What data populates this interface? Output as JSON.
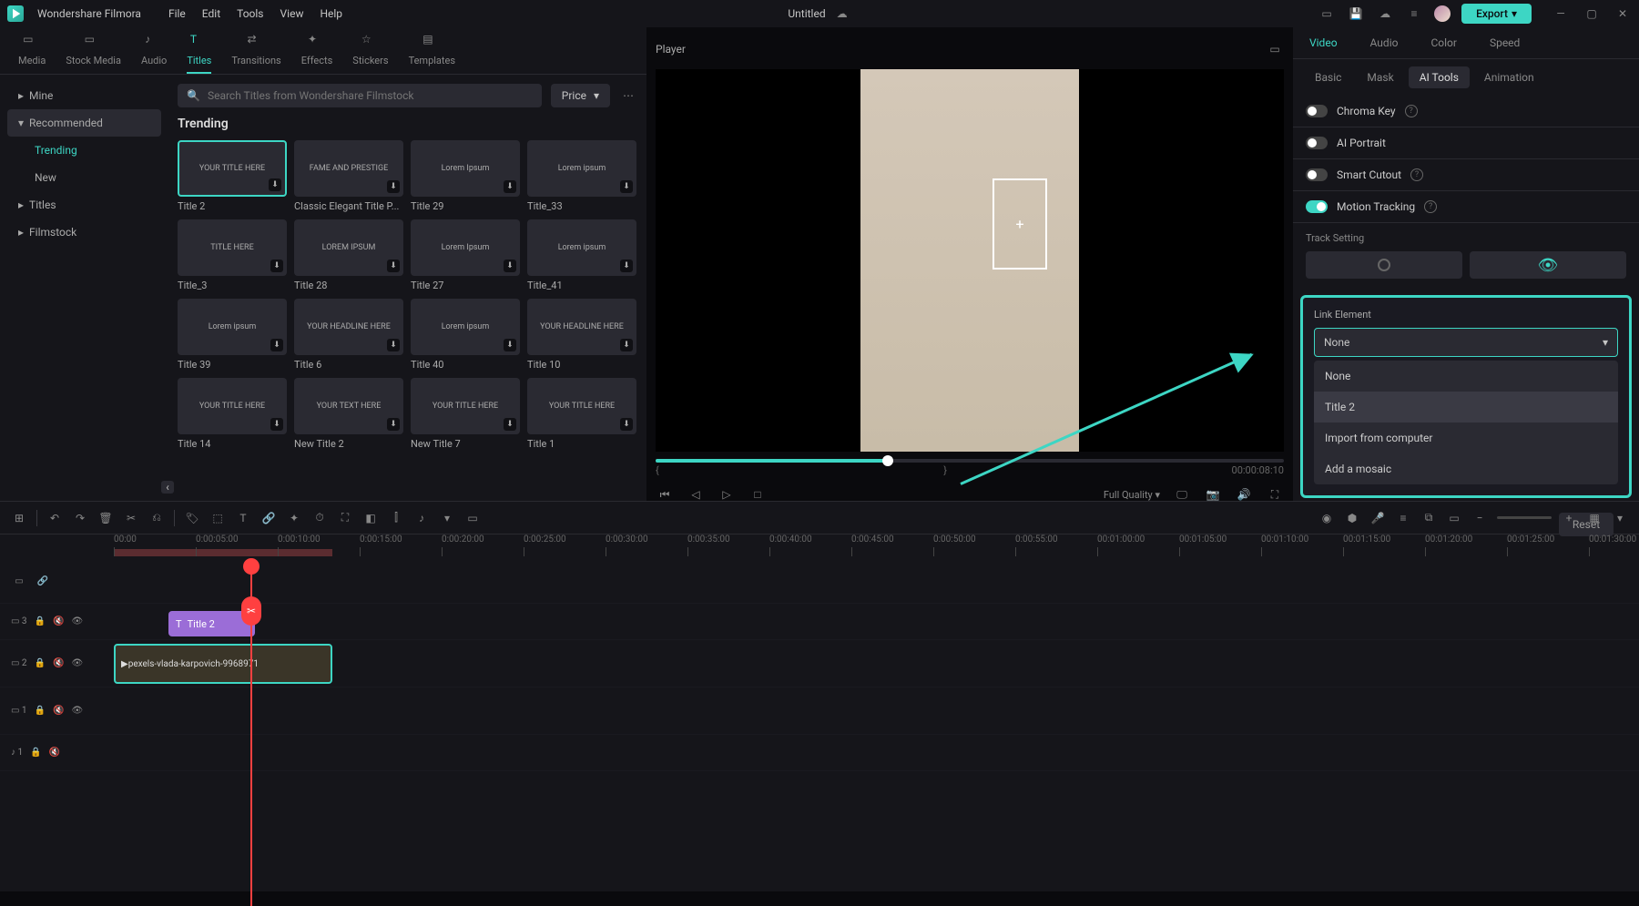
{
  "app": {
    "name": "Wondershare Filmora",
    "doc_title": "Untitled"
  },
  "menu": [
    "File",
    "Edit",
    "Tools",
    "View",
    "Help"
  ],
  "export_label": "Export",
  "media_tabs": [
    {
      "label": "Media"
    },
    {
      "label": "Stock Media"
    },
    {
      "label": "Audio"
    },
    {
      "label": "Titles",
      "active": true
    },
    {
      "label": "Transitions"
    },
    {
      "label": "Effects"
    },
    {
      "label": "Stickers"
    },
    {
      "label": "Templates"
    }
  ],
  "sidebar": {
    "mine": "Mine",
    "recommended": "Recommended",
    "trending": "Trending",
    "new": "New",
    "titles": "Titles",
    "filmstock": "Filmstock"
  },
  "search": {
    "placeholder": "Search Titles from Wondershare Filmstock"
  },
  "price_label": "Price",
  "section_title": "Trending",
  "thumbs": [
    {
      "label": "Title 2",
      "text": "YOUR TITLE HERE",
      "selected": true
    },
    {
      "label": "Classic Elegant Title P...",
      "text": "FAME AND PRESTIGE"
    },
    {
      "label": "Title 29",
      "text": "Lorem Ipsum"
    },
    {
      "label": "Title_33",
      "text": "Lorem ipsum"
    },
    {
      "label": "Title_3",
      "text": "TITLE HERE"
    },
    {
      "label": "Title 28",
      "text": "LOREM IPSUM"
    },
    {
      "label": "Title 27",
      "text": "Lorem Ipsum"
    },
    {
      "label": "Title_41",
      "text": "Lorem ipsum"
    },
    {
      "label": "Title 39",
      "text": "Lorem ipsum"
    },
    {
      "label": "Title 6",
      "text": "YOUR HEADLINE HERE"
    },
    {
      "label": "Title 40",
      "text": "Lorem ipsum"
    },
    {
      "label": "Title 10",
      "text": "YOUR HEADLINE HERE"
    },
    {
      "label": "Title 14",
      "text": "YOUR TITLE HERE"
    },
    {
      "label": "New Title 2",
      "text": "YOUR TEXT HERE"
    },
    {
      "label": "New Title 7",
      "text": "YOUR TITLE HERE"
    },
    {
      "label": "Title 1",
      "text": "YOUR TITLE HERE"
    }
  ],
  "player": {
    "title": "Player",
    "timecode": "00:00:08:10",
    "quality": "Full Quality"
  },
  "prop_tabs": [
    "Video",
    "Audio",
    "Color",
    "Speed"
  ],
  "prop_subtabs": [
    "Basic",
    "Mask",
    "AI Tools",
    "Animation"
  ],
  "ai_tools": {
    "chroma_key": "Chroma Key",
    "ai_portrait": "AI Portrait",
    "smart_cutout": "Smart Cutout",
    "motion_tracking": "Motion Tracking",
    "track_setting": "Track Setting",
    "link_element": "Link Element",
    "link_value": "None",
    "options": [
      "None",
      "Title 2",
      "Import from computer",
      "Add a mosaic"
    ],
    "reset": "Reset"
  },
  "timeline": {
    "ruler": [
      "00:00",
      "0:00:05:00",
      "0:00:10:00",
      "0:00:15:00",
      "0:00:20:00",
      "0:00:25:00",
      "0:00:30:00",
      "0:00:35:00",
      "0:00:40:00",
      "0:00:45:00",
      "0:00:50:00",
      "0:00:55:00",
      "00:01:00:00",
      "00:01:05:00",
      "00:01:10:00",
      "00:01:15:00",
      "00:01:20:00",
      "00:01:25:00",
      "00:01:30:00"
    ],
    "tracks": [
      {
        "id": "3",
        "type": "video"
      },
      {
        "id": "2",
        "type": "video"
      },
      {
        "id": "1",
        "type": "video"
      },
      {
        "id": "1",
        "type": "audio"
      }
    ],
    "title_clip": "Title 2",
    "video_clip": "pexels-vlada-karpovich-9968971"
  }
}
